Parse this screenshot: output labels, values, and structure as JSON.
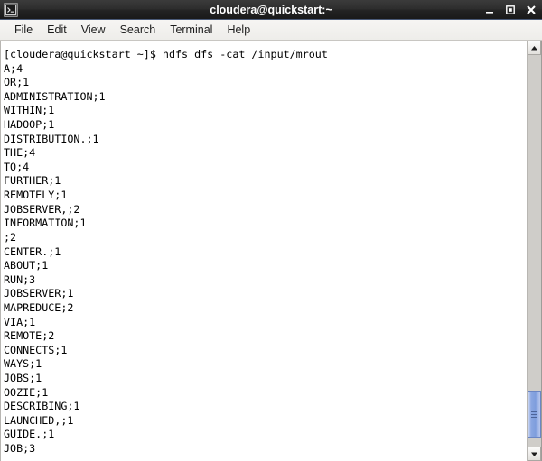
{
  "window": {
    "title": "cloudera@quickstart:~",
    "icon": "terminal-icon",
    "controls": {
      "minimize": "minimize-icon",
      "maximize": "maximize-icon",
      "close": "close-icon"
    }
  },
  "menubar": {
    "items": [
      {
        "label": "File"
      },
      {
        "label": "Edit"
      },
      {
        "label": "View"
      },
      {
        "label": "Search"
      },
      {
        "label": "Terminal"
      },
      {
        "label": "Help"
      }
    ]
  },
  "terminal": {
    "prompt": "[cloudera@quickstart ~]$",
    "command": "hdfs dfs -cat /input/mrout",
    "command_line": "[cloudera@quickstart ~]$ hdfs dfs -cat /input/mrout",
    "lines": [
      "[cloudera@quickstart ~]$ hdfs dfs -cat /input/mrout",
      "A;4",
      "OR;1",
      "ADMINISTRATION;1",
      "WITHIN;1",
      "HADOOP;1",
      "DISTRIBUTION.;1",
      "THE;4",
      "TO;4",
      "FURTHER;1",
      "REMOTELY;1",
      "JOBSERVER,;2",
      "INFORMATION;1",
      ";2",
      "CENTER.;1",
      "ABOUT;1",
      "RUN;3",
      "JOBSERVER;1",
      "MAPREDUCE;2",
      "VIA;1",
      "REMOTE;2",
      "CONNECTS;1",
      "WAYS;1",
      "JOBS;1",
      "OOZIE;1",
      "DESCRIBING;1",
      "LAUNCHED,;1",
      "GUIDE.;1",
      "JOB;3"
    ]
  },
  "scrollbar": {
    "up_arrow": "scroll-up-icon",
    "down_arrow": "scroll-down-icon",
    "thumb": "scrollbar-thumb"
  },
  "colors": {
    "titlebar": "#2b2b2b",
    "titlebar_text": "#ffffff",
    "menubar": "#f1f0ee",
    "terminal_bg": "#ffffff",
    "terminal_fg": "#000000",
    "scrollbar_thumb": "#8ba7e2",
    "scrollbar_track": "#cfcdc9"
  }
}
